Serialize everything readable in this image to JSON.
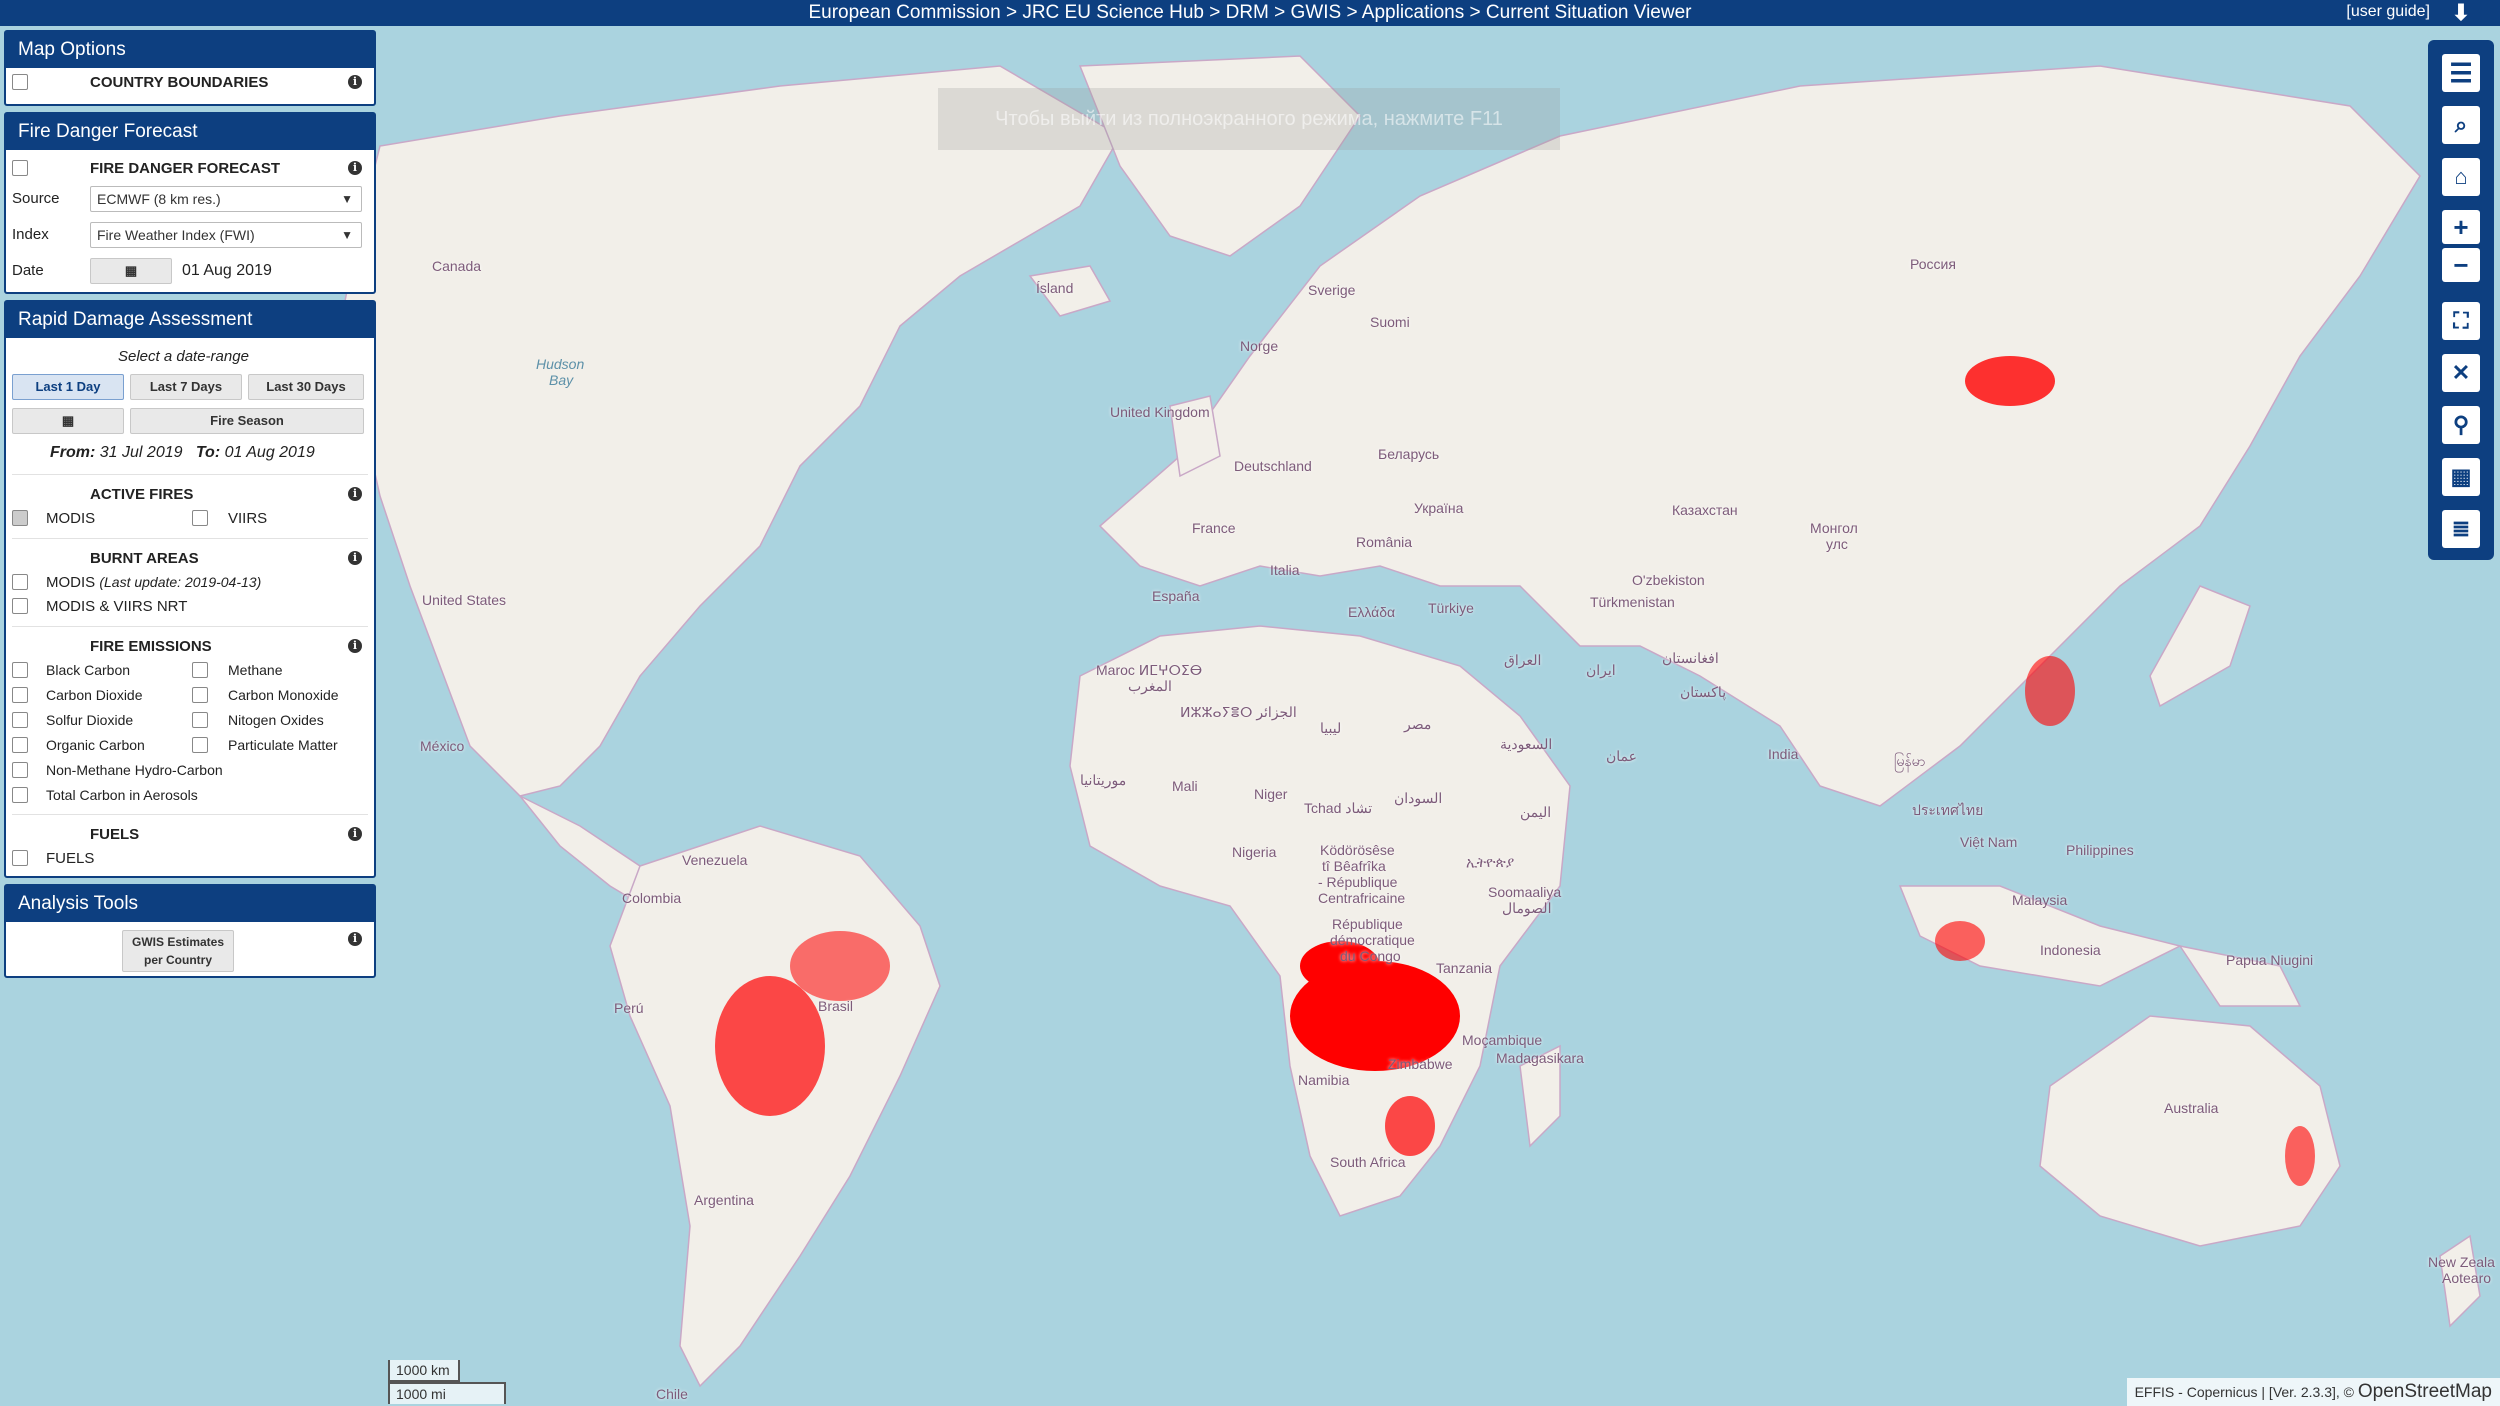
{
  "topbar": {
    "breadcrumb": "European Commission > JRC EU Science Hub > DRM > GWIS > Applications > Current Situation Viewer",
    "user_guide": "[user guide]",
    "download_icon": "download-arrow-icon"
  },
  "overlay_message": "Чтобы выйти из полноэкранного режима, нажмите F11",
  "map_options": {
    "title": "Map Options",
    "country_boundaries": "COUNTRY BOUNDARIES"
  },
  "fire_danger": {
    "title": "Fire Danger Forecast",
    "layer": "FIRE DANGER FORECAST",
    "source_label": "Source",
    "source_value": "ECMWF (8 km res.)",
    "index_label": "Index",
    "index_value": "Fire Weather Index (FWI)",
    "date_label": "Date",
    "date_value": "01 Aug 2019"
  },
  "rapid_damage": {
    "title": "Rapid Damage Assessment",
    "subtitle": "Select a date-range",
    "btn_1day": "Last 1 Day",
    "btn_7days": "Last 7 Days",
    "btn_30days": "Last 30 Days",
    "btn_fire_season": "Fire Season",
    "from_label": "From:",
    "from_value": "31 Jul 2019",
    "to_label": "To:",
    "to_value": "01 Aug 2019",
    "active_fires": "ACTIVE FIRES",
    "modis": "MODIS",
    "viirs": "VIIRS",
    "burnt_areas": "BURNT AREAS",
    "burnt_modis": "MODIS",
    "burnt_modis_update": "(Last update: 2019-04-13)",
    "burnt_modis_viirs": "MODIS & VIIRS NRT",
    "fire_emissions": "FIRE EMISSIONS",
    "black_carbon": "Black Carbon",
    "methane": "Methane",
    "carbon_dioxide": "Carbon Dioxide",
    "carbon_monoxide": "Carbon Monoxide",
    "solfur_dioxide": "Solfur Dioxide",
    "nitogen_oxides": "Nitogen Oxides",
    "organic_carbon": "Organic Carbon",
    "particulate_matter": "Particulate Matter",
    "nmhc": "Non-Methane Hydro-Carbon",
    "tca": "Total Carbon in Aerosols",
    "fuels_header": "FUELS",
    "fuels": "FUELS"
  },
  "analysis": {
    "title": "Analysis Tools",
    "gwis_line1": "GWIS Estimates",
    "gwis_line2": "per Country"
  },
  "map_labels": {
    "canada": "Canada",
    "united_states": "United States",
    "mexico": "México",
    "hudson_bay_1": "Hudson",
    "hudson_bay_2": "Bay",
    "island": "Ísland",
    "sverige": "Sverige",
    "suomi": "Suomi",
    "norge": "Norge",
    "uk": "United Kingdom",
    "deutschland": "Deutschland",
    "belarus": "Беларусь",
    "ukraine": "Україна",
    "france": "France",
    "romania": "România",
    "italia": "Italia",
    "espana": "España",
    "ellada": "Ελλάδα",
    "turkiye": "Türkiye",
    "russia": "Россия",
    "kazakhstan": "Казахстан",
    "uzbekistan": "O'zbekiston",
    "turkmenistan": "Türkmenistan",
    "mongolia_1": "Монгол",
    "mongolia_2": "улс",
    "iraq": "العراق",
    "iran": "ایران",
    "afghanistan": "افغانستان",
    "pakistan": "پاکستان",
    "india": "India",
    "saudi": "السعودية",
    "oman": "عمان",
    "yemen": "اليمن",
    "morocco_1": "Maroc ⵍⵎⵖⵔⵉⴱ",
    "morocco_2": "المغرب",
    "algeria": "ⵍⵣⵣⴰⵢⴻⵔ الجزائر",
    "libya": "ليبيا",
    "egypt": "مصر",
    "sudan": "السودان",
    "tchad": "Tchad تشاد",
    "mauritania": "موريتانيا",
    "mali": "Mali",
    "niger": "Niger",
    "nigeria": "Nigeria",
    "ethiopia": "ኢትዮጵያ",
    "somalia_1": "Soomaaliya",
    "somalia_2": "الصومال",
    "car_1": "Ködörösêse",
    "car_2": "tî Bêafrîka",
    "car_3": "- République",
    "car_4": "Centrafricaine",
    "drc_1": "République",
    "drc_2": "démocratique",
    "drc_3": "du Congo",
    "tanzania": "Tanzania",
    "mozambique": "Moçambique",
    "madagascar": "Madagasikara",
    "namibia": "Namibia",
    "zimbabwe": "Zimbabwe",
    "south_africa": "South Africa",
    "venezuela": "Venezuela",
    "colombia": "Colombia",
    "peru": "Perú",
    "brasil": "Brasil",
    "argentina": "Argentina",
    "chile": "Chile",
    "vietnam": "Việt Nam",
    "philippines": "Philippines",
    "malaysia": "Malaysia",
    "indonesia": "Indonesia",
    "png": "Papua Niugini",
    "australia": "Australia",
    "nz_1": "New Zeala",
    "nz_2": "Aotearo",
    "thailand": "ประเทศไทย",
    "myanmar": "မြန်မာ"
  },
  "toolbar": {
    "menu_icon": "menu-icon",
    "search_icon": "search-icon",
    "home_icon": "home-icon",
    "zoom_in_icon": "zoom-in-icon",
    "zoom_out_icon": "zoom-out-icon",
    "fullscreen_icon": "fullscreen-icon",
    "extent_icon": "extent-icon",
    "location_icon": "location-pin-icon",
    "grid_icon": "grid-icon",
    "list_icon": "list-icon"
  },
  "scale": {
    "km": "1000 km",
    "mi": "1000 mi"
  },
  "attribution": {
    "text": "EFFIS - Copernicus | [Ver. 2.3.3], ©",
    "osm": "OpenStreetMap"
  },
  "colors": {
    "header": "#0d3f80",
    "ocean": "#aad3df",
    "land": "#f2efe9",
    "fire": "#ff0000"
  }
}
